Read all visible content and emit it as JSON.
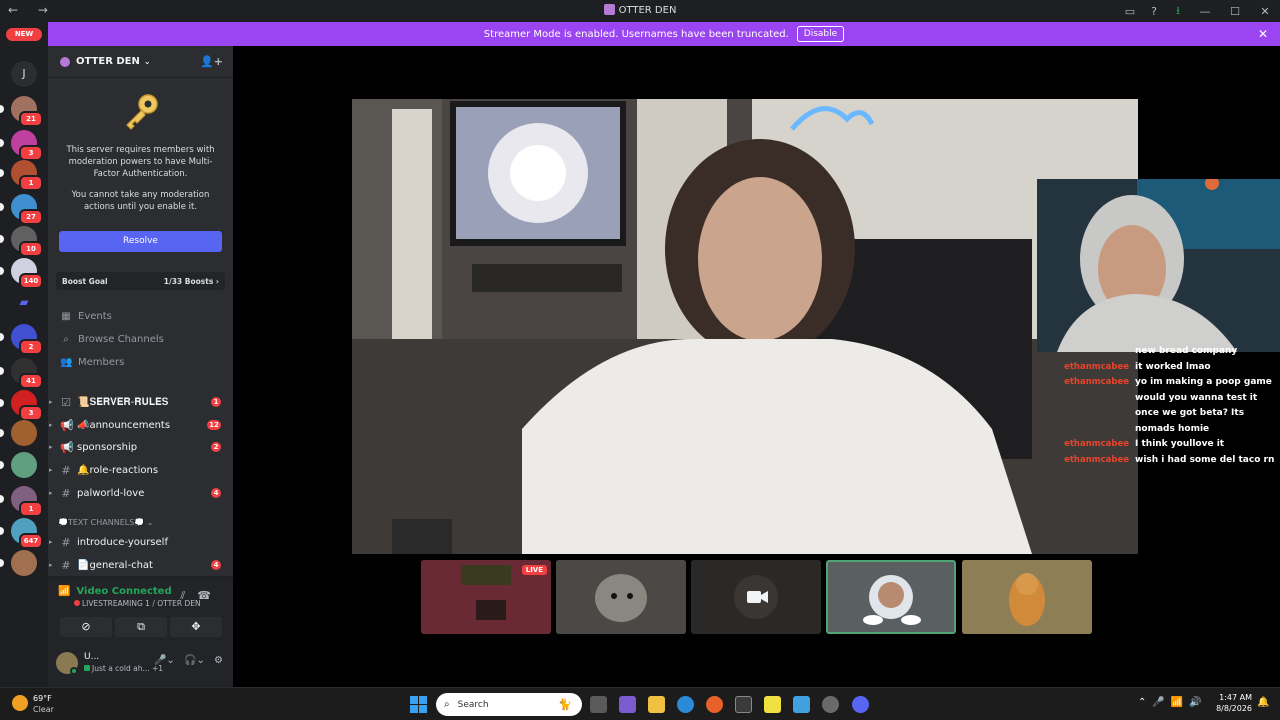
{
  "window": {
    "title": "OTTER DEN",
    "nav": "← →",
    "controls": [
      "▭",
      "?",
      "⭳",
      "—",
      "☐",
      "✕"
    ]
  },
  "banner": {
    "message": "Streamer Mode is enabled. Usernames have been truncated.",
    "disable_label": "Disable",
    "close": "✕"
  },
  "rail": {
    "new_label": "NEW",
    "j_label": "J",
    "servers": [
      {
        "badge": "21",
        "color": "#a07060"
      },
      {
        "badge": "3",
        "color": "#c040a0"
      },
      {
        "badge": "1",
        "color": "#b05030"
      },
      {
        "badge": "27",
        "color": "#4090d0"
      },
      {
        "badge": "10",
        "color": "#606060"
      },
      {
        "badge": "140",
        "color": "#d0d0e0"
      },
      {
        "badge": "2",
        "color": "#4050d0"
      },
      {
        "badge": "41",
        "color": "#303030"
      },
      {
        "badge": "3",
        "color": "#d02020"
      },
      {
        "badge": "",
        "color": "#a06030"
      },
      {
        "badge": "",
        "color": "#60a080"
      },
      {
        "badge": "1",
        "color": "#806080"
      },
      {
        "badge": "647",
        "color": "#50a0c0"
      },
      {
        "badge": "",
        "color": "#a07050"
      }
    ]
  },
  "sidebar": {
    "server_name": "OTTER DEN",
    "mfa_line1": "This server requires members with moderation powers to have Multi-Factor Authentication.",
    "mfa_line2": "You cannot take any moderation actions until you enable it.",
    "resolve_label": "Resolve",
    "boost_label": "Boost Goal",
    "boost_value": "1/33 Boosts",
    "nav": [
      {
        "icon": "▦",
        "label": "Events"
      },
      {
        "icon": "⌕",
        "label": "Browse Channels"
      },
      {
        "icon": "👥",
        "label": "Members"
      }
    ],
    "channels": [
      {
        "icon": "☑",
        "name": "📜𝐒𝐄𝐑𝐕𝐄𝐑-𝐑𝐔𝐋𝐄𝐒",
        "badge": "1"
      },
      {
        "icon": "📢",
        "name": "📣announcements",
        "badge": "12"
      },
      {
        "icon": "📢",
        "name": "sponsorship",
        "badge": "2"
      },
      {
        "icon": "#",
        "name": "🔔role-reactions",
        "badge": ""
      },
      {
        "icon": "#",
        "name": "palworld-love",
        "badge": "4"
      }
    ],
    "category": "💭TEXT CHANNELS💭 ⌄",
    "channels2": [
      {
        "icon": "#",
        "name": "introduce-yourself",
        "badge": ""
      },
      {
        "icon": "#",
        "name": "📄general-chat",
        "badge": "4"
      }
    ],
    "voice_status": "Video Connected",
    "voice_sub": "LIVESTREAMING 1 / OTTER DEN",
    "user_name": "U...",
    "user_status": "Just a cold ah... +1"
  },
  "chat": [
    {
      "name": "",
      "msg": "new bread company"
    },
    {
      "name": "ethanmcabee",
      "msg": "it worked lmao"
    },
    {
      "name": "ethanmcabee",
      "msg": "yo im making a poop game would you wanna test it once we got beta? Its nomads homie"
    },
    {
      "name": "ethanmcabee",
      "msg": "I think youllove it"
    },
    {
      "name": "ethanmcabee",
      "msg": "wish i had some del taco rn"
    }
  ],
  "thumbs": {
    "live_label": "LIVE"
  },
  "taskbar": {
    "temp": "69°F",
    "weather": "Clear",
    "search_placeholder": "Search",
    "time": "1:47 AM",
    "date": "8/8/2026"
  }
}
